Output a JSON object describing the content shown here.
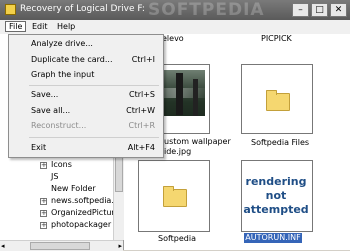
{
  "window": {
    "title": "Recovery of Logical Drive F:",
    "watermark": "SOFTPEDIA",
    "controls": [
      "–",
      "□",
      "✕"
    ]
  },
  "menubar": {
    "file": "File",
    "edit": "Edit",
    "help": "Help"
  },
  "file_menu": {
    "items": [
      {
        "label": "Analyze drive...",
        "shortcut": "",
        "enabled": true
      },
      {
        "label": "Duplicate the card...",
        "shortcut": "Ctrl+I",
        "enabled": true
      },
      {
        "label": "Graph the input",
        "shortcut": "",
        "enabled": true
      },
      {
        "label": "Save...",
        "shortcut": "Ctrl+S",
        "enabled": true
      },
      {
        "label": "Save all...",
        "shortcut": "Ctrl+W",
        "enabled": true
      },
      {
        "label": "Reconstruct...",
        "shortcut": "Ctrl+R",
        "enabled": false
      },
      {
        "label": "Exit",
        "shortcut": "Alt+F4",
        "enabled": true
      }
    ]
  },
  "tree": {
    "items": [
      {
        "label": "Icons",
        "expandable": true
      },
      {
        "label": "JS",
        "expandable": false
      },
      {
        "label": "New Folder",
        "expandable": false
      },
      {
        "label": "news.softpedia.cc",
        "expandable": true
      },
      {
        "label": "OrganizedPictures",
        "expandable": true
      },
      {
        "label": "photopackager",
        "expandable": true
      }
    ]
  },
  "files": {
    "top_left_label": "elevo",
    "top_right_label": "PICPICK",
    "photo_caption_line1": "ustom wallpaper",
    "photo_caption_line2": "ide.jpg",
    "folder_caption": "Softpedia Files",
    "folder2_caption": "Softpedia",
    "render_line1": "rendering",
    "render_line2": "not",
    "render_line3": "attempted",
    "selected_caption": "AUTORUN.INF"
  },
  "colors": {
    "selection": "#3565b8",
    "render_text": "#1f4e86",
    "folder": "#f5d770"
  }
}
